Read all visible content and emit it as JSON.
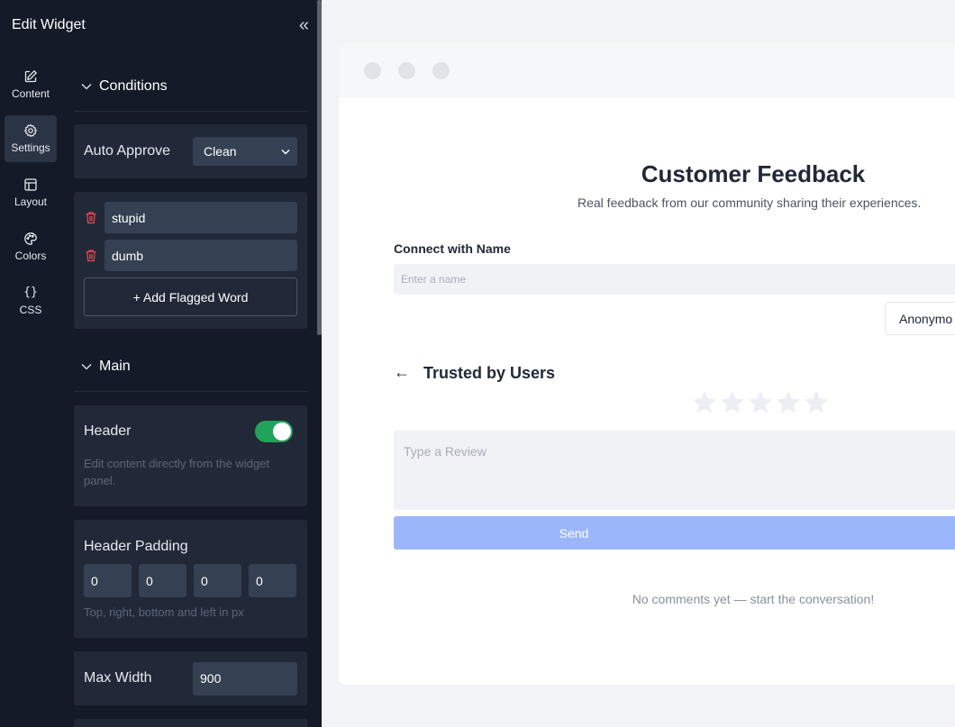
{
  "editor": {
    "title": "Edit Widget",
    "rail": [
      {
        "label": "Content",
        "icon": "edit-icon"
      },
      {
        "label": "Settings",
        "icon": "gear-icon"
      },
      {
        "label": "Layout",
        "icon": "layout-icon"
      },
      {
        "label": "Colors",
        "icon": "palette-icon"
      },
      {
        "label": "CSS",
        "icon": "code-braces-icon",
        "glyph": "{}"
      }
    ],
    "active_tab": "Settings",
    "conditions": {
      "heading": "Conditions",
      "auto_approve_label": "Auto Approve",
      "auto_approve_value": "Clean",
      "flagged_words": [
        "stupid",
        "dumb"
      ],
      "add_button": "+ Add Flagged Word"
    },
    "main": {
      "heading": "Main",
      "header_label": "Header",
      "header_enabled": true,
      "header_help": "Edit content directly from the widget panel.",
      "padding_label": "Header Padding",
      "padding": [
        "0",
        "0",
        "0",
        "0"
      ],
      "padding_help": "Top, right, bottom and left in px",
      "max_width_label": "Max Width",
      "max_width_value": "900"
    }
  },
  "preview": {
    "title": "Customer Feedback",
    "subtitle": "Real feedback from our community sharing their experiences.",
    "connect_label": "Connect with Name",
    "name_placeholder": "Enter a name",
    "anonymous_button": "Anonymo",
    "back_arrow": "←",
    "section_title": "Trusted by Users",
    "rating": 0,
    "rating_max": 5,
    "review_placeholder": "Type a Review",
    "send_button": "Send",
    "empty_message": "No comments yet — start the conversation!"
  },
  "colors": {
    "panel_bg": "#141a28",
    "card_bg": "#212938",
    "input_bg": "#354052",
    "toggle_on": "#22a35a",
    "trash": "#e5484d",
    "send_button": "#9bb6fb",
    "star_empty": "#eceef4"
  }
}
